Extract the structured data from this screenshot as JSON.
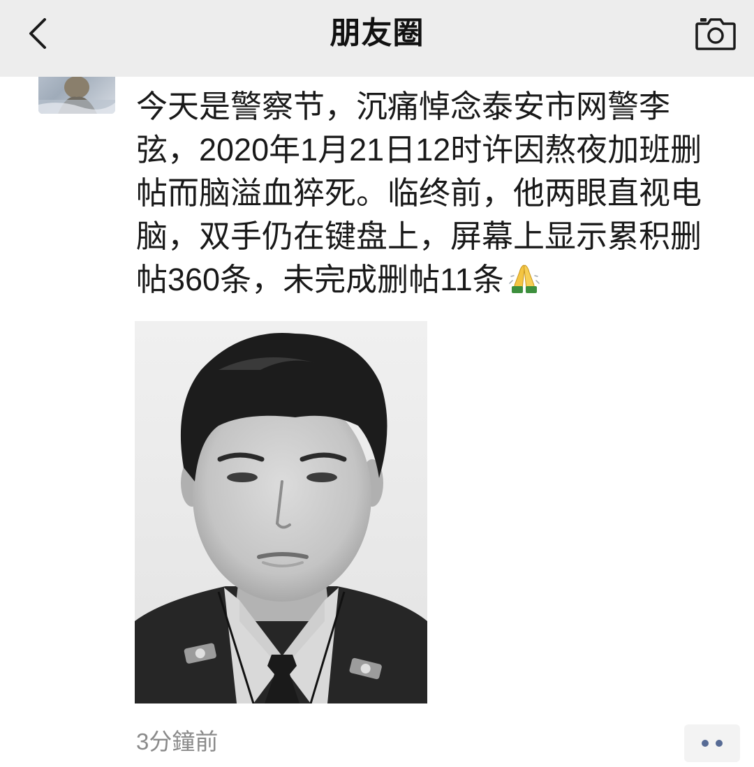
{
  "nav": {
    "title": "朋友圈",
    "back_icon": "chevron-left-icon",
    "camera_icon": "camera-icon"
  },
  "post": {
    "avatar_icon": "avatar-photo",
    "text_lines": [
      "今天是警察节，沉痛悼念泰安市网警李",
      "弦，2020年1月21日12时许因熬夜加班删",
      "帖而脑溢血猝死。临终前，他两眼直视电",
      "脑，双手仍在键盘上，屏幕上显示累积删",
      "帖360条，未完成删帖11条"
    ],
    "trailing_emoji_icon": "folded-hands-emoji-icon",
    "photo": "black-and-white-portrait-photo",
    "timestamp": "3分鐘前",
    "more_icon": "more-dots-icon"
  },
  "colors": {
    "navbar_bg": "#ededed",
    "text": "#191919",
    "timestamp": "#8a8a8a",
    "more_button_bg": "#f3f3f3",
    "more_dots": "#576b95"
  }
}
